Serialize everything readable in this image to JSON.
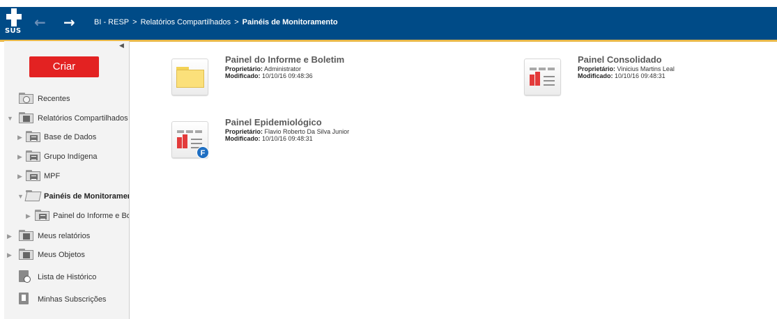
{
  "header": {
    "logo_text": "SUS",
    "breadcrumb": [
      "BI - RESP",
      "Relatórios Compartilhados",
      "Painéis de Monitoramento"
    ],
    "separator": ">",
    "colors": {
      "bar": "#004b87",
      "accent_line": "#e8b84a"
    }
  },
  "sidebar": {
    "create_button": "Criar",
    "items": [
      {
        "label": "Recentes",
        "icon": "recent-folder-icon"
      },
      {
        "label": "Relatórios Compartilhados",
        "icon": "shared-folder-icon"
      },
      {
        "label": "Base de Dados",
        "icon": "report-folder-icon"
      },
      {
        "label": "Grupo Indígena",
        "icon": "report-folder-icon"
      },
      {
        "label": "MPF",
        "icon": "report-folder-icon"
      },
      {
        "label": "Painéis de Monitoramento",
        "icon": "open-folder-icon"
      },
      {
        "label": "Painel do Informe e Boletim",
        "icon": "report-folder-icon"
      },
      {
        "label": "Meus relatórios",
        "icon": "user-folder-icon"
      },
      {
        "label": "Meus Objetos",
        "icon": "objects-folder-icon"
      },
      {
        "label": "Lista de Histórico",
        "icon": "history-icon"
      },
      {
        "label": "Minhas Subscrições",
        "icon": "subscription-icon"
      }
    ]
  },
  "main": {
    "owner_label": "Proprietário:",
    "modified_label": "Modificado:",
    "items": [
      {
        "title": "Painel do Informe e Boletim",
        "owner": "Administrator",
        "modified": "10/10/16 09:48:36",
        "icon": "folder-icon"
      },
      {
        "title": "Painel Consolidado",
        "owner": "Vinicius Martins Leal",
        "modified": "10/10/16 09:48:31",
        "icon": "dashboard-icon"
      },
      {
        "title": "Painel Epidemiológico",
        "owner": "Flavio Roberto Da Silva Junior",
        "modified": "10/10/16 09:48:31",
        "icon": "dashboard-icon",
        "badge": "F"
      }
    ]
  }
}
